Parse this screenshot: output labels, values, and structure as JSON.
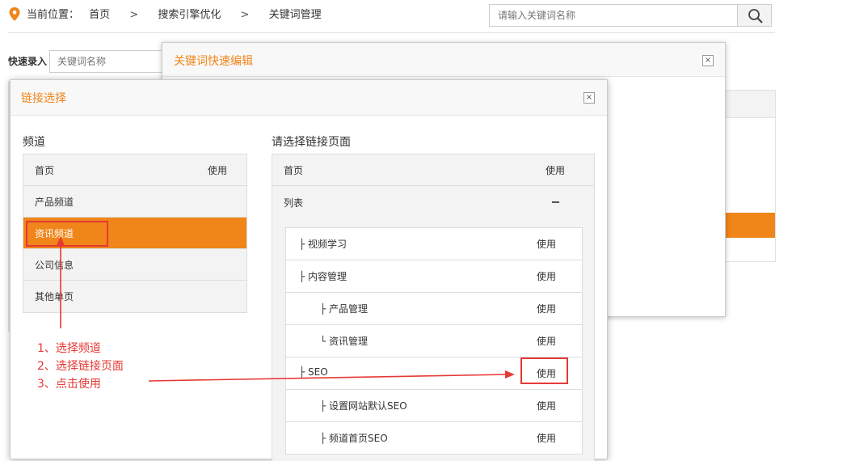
{
  "header": {
    "location_label": "当前位置：",
    "breadcrumb": [
      "首页",
      "搜索引擎优化",
      "关键词管理"
    ],
    "breadcrumb_sep": ">",
    "search_placeholder": "请输入关键词名称"
  },
  "quick_entry": {
    "label": "快速录入",
    "placeholder": "关键词名称"
  },
  "keyword_dialog": {
    "title": "关键词快速编辑",
    "close": "×"
  },
  "link_dialog": {
    "title": "链接选择",
    "close": "×",
    "channel_heading": "频道",
    "page_heading": "请选择链接页面",
    "channels": [
      {
        "label": "首页",
        "use": "使用"
      },
      {
        "label": "产品频道"
      },
      {
        "label": "资讯频道",
        "active": true
      },
      {
        "label": "公司信息"
      },
      {
        "label": "其他单页"
      }
    ],
    "pages": {
      "home": {
        "label": "首页",
        "use": "使用"
      },
      "list": {
        "label": "列表"
      },
      "items": [
        {
          "label": "├ 视频学习",
          "use": "使用"
        },
        {
          "label": "├ 内容管理",
          "use": "使用"
        },
        {
          "label": "├ 产品管理",
          "use": "使用"
        },
        {
          "label": "└ 资讯管理",
          "use": "使用"
        },
        {
          "label": "├ SEO",
          "use": "使用"
        },
        {
          "label": "├ 设置网站默认SEO",
          "use": "使用"
        },
        {
          "label": "├ 频道首页SEO",
          "use": "使用"
        }
      ]
    }
  },
  "annotations": {
    "steps": [
      "1、选择频道",
      "2、选择链接页面",
      "3、点击使用"
    ],
    "color": "#e53935"
  },
  "colors": {
    "accent": "#f08519"
  }
}
